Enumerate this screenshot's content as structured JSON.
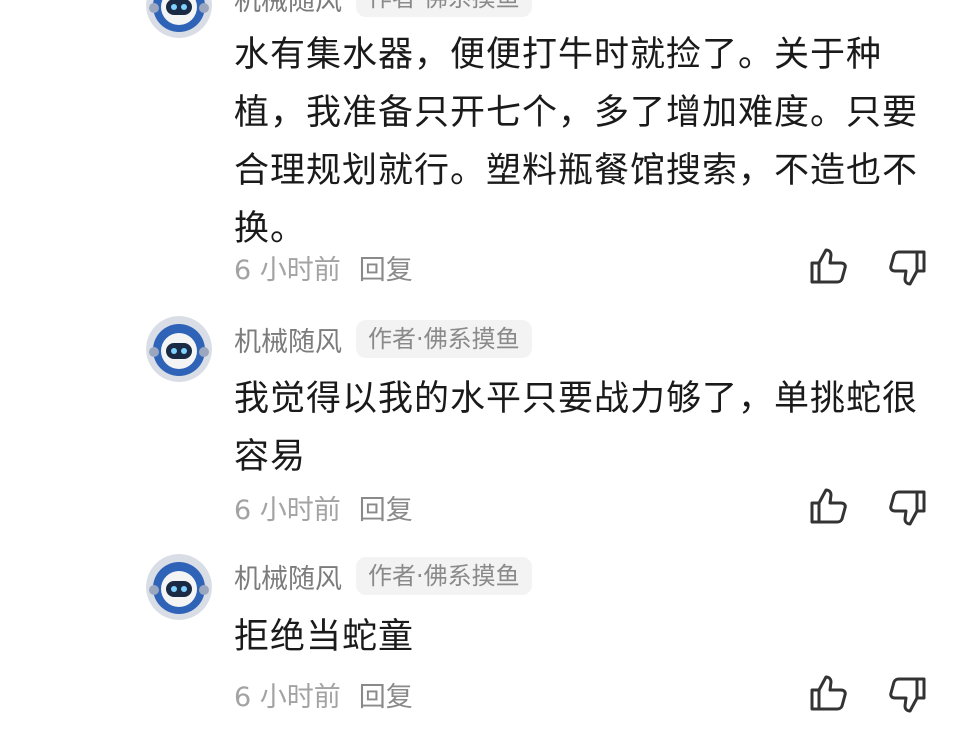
{
  "comments": [
    {
      "username": "机械随风",
      "badge": "作者·佛系摸鱼",
      "text": "水有集水器，便便打牛时就捡了。关于种植，我准备只开七个，多了增加难度。只要合理规划就行。塑料瓶餐馆搜索，不造也不换。",
      "time": "6 小时前",
      "reply_label": "回复"
    },
    {
      "username": "机械随风",
      "badge": "作者·佛系摸鱼",
      "text": "我觉得以我的水平只要战力够了，单挑蛇很容易",
      "time": "6 小时前",
      "reply_label": "回复"
    },
    {
      "username": "机械随风",
      "badge": "作者·佛系摸鱼",
      "text": "拒绝当蛇童",
      "time": "6 小时前",
      "reply_label": "回复"
    }
  ],
  "icons": {
    "avatar": "robot-avatar-icon",
    "like": "thumbs-up-icon",
    "dislike": "thumbs-down-icon"
  },
  "colors": {
    "text_primary": "#1a1a1a",
    "text_secondary": "#8a8a8a",
    "badge_bg": "#f3f3f3",
    "avatar_blue": "#2f63b8"
  }
}
